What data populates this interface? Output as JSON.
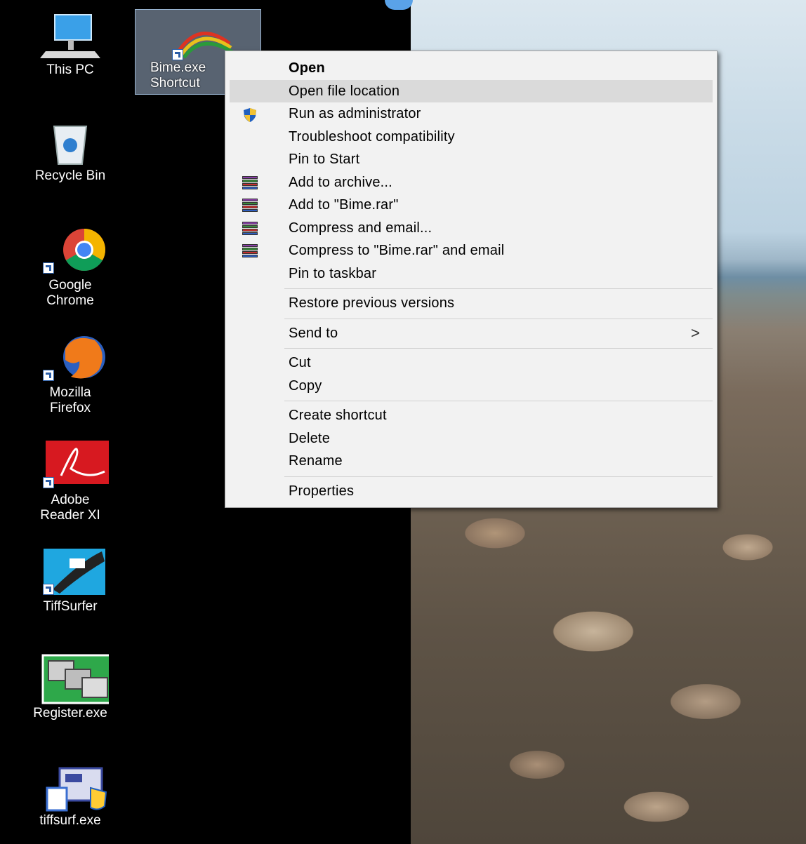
{
  "desktop": {
    "icons": [
      {
        "label": "This PC"
      },
      {
        "label": "Bime.exe\nShortcut"
      },
      {
        "label": "Recycle Bin"
      },
      {
        "label": "Google\nChrome"
      },
      {
        "label": "Mozilla\nFirefox"
      },
      {
        "label": "Adobe\nReader XI"
      },
      {
        "label": "TiffSurfer"
      },
      {
        "label": "Register.exe"
      },
      {
        "label": "tiffsurf.exe"
      }
    ]
  },
  "context_menu": {
    "open": "Open",
    "open_file_location": "Open file location",
    "run_as_admin": "Run as administrator",
    "troubleshoot": "Troubleshoot compatibility",
    "pin_to_start": "Pin to Start",
    "add_to_archive": "Add to archive...",
    "add_to_rar": "Add to \"Bime.rar\"",
    "compress_email": "Compress and email...",
    "compress_rar_email": "Compress to \"Bime.rar\" and email",
    "pin_to_taskbar": "Pin to taskbar",
    "restore_versions": "Restore previous versions",
    "send_to": "Send to",
    "cut": "Cut",
    "copy": "Copy",
    "create_shortcut": "Create shortcut",
    "delete": "Delete",
    "rename": "Rename",
    "properties": "Properties",
    "submenu_glyph": ">"
  },
  "colors": {
    "menu_bg": "#f2f2f2",
    "hover_bg": "#dadada",
    "desktop_bg": "#000000"
  }
}
